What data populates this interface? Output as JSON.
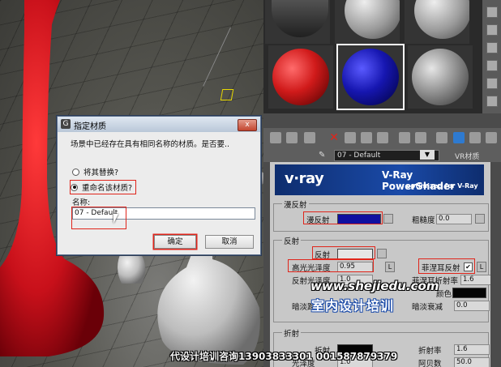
{
  "dialog": {
    "title": "指定材质",
    "message": "场景中已经存在具有相同名称的材质。是否要..",
    "options": [
      {
        "label": "将其替换?",
        "selected": false
      },
      {
        "label": "重命名该材质?",
        "selected": true
      }
    ],
    "name_label": "名称:",
    "name_value": "07 - Default",
    "ok_label": "确定",
    "cancel_label": "取消",
    "close_symbol": "x"
  },
  "material_editor": {
    "slots": [
      {
        "name": "environment-slot",
        "color": "#3a3a3a"
      },
      {
        "name": "gray-slot",
        "color": "#8a8a8a"
      },
      {
        "name": "gray-slot",
        "color": "#8a8a8a"
      },
      {
        "name": "red-slot",
        "color": "#d01a1a"
      },
      {
        "name": "blue-slot",
        "color": "#1616b0"
      },
      {
        "name": "gray-slot",
        "color": "#8a8a8a"
      }
    ],
    "material_name": "07 - Default",
    "material_type": "VR材质",
    "banner": {
      "logo": "v·ray",
      "title": "V-Ray PowerShader",
      "subtitle": "optimized for V-Ray"
    },
    "diffuse": {
      "group_title": "漫反射",
      "diffuse_label": "漫反射",
      "diffuse_color": "#1010a0",
      "roughness_label": "粗糙度",
      "roughness_value": "0.0"
    },
    "reflect": {
      "group_title": "反射",
      "reflect_label": "反射",
      "reflect_color": "#e6e6e6",
      "hilight_gloss_label": "高光光泽度",
      "hilight_gloss_value": "0.95",
      "lock_label": "L",
      "fresnel_label": "菲涅耳反射",
      "fresnel_checked": "✔",
      "fresnel_lock_label": "L",
      "refl_gloss_label": "反射光泽度",
      "refl_gloss_value": "1.0",
      "fresnel_ior_label": "菲涅耳折射率",
      "fresnel_ior_value": "1.6",
      "exit_color_label": "颜色",
      "dim_distance_label": "暗淡距离",
      "dim_falloff_label": "暗淡衰减",
      "dim_falloff_value": "0.0"
    },
    "refract": {
      "group_title": "折射",
      "refract_label": "折射",
      "ior_label": "折射率",
      "ior_value": "1.6",
      "gloss_label": "光泽度",
      "gloss_value": "1.0",
      "abbe_label": "阿贝数",
      "abbe_value": "50.0"
    },
    "colors": {
      "accent_red_mark": "#e0251b"
    }
  },
  "watermarks": {
    "url": "www.shejiedu.com",
    "name": "室内设计培训",
    "contact": "代设计培训咨询13903833301 001587879379"
  }
}
